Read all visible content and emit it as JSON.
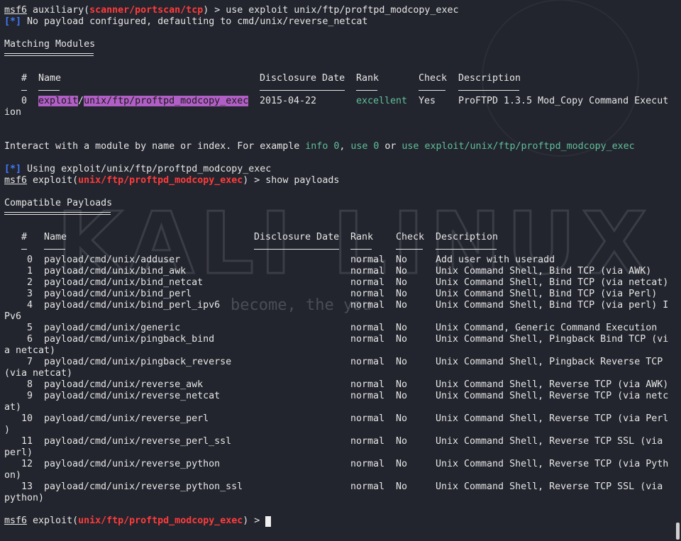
{
  "prompt1": {
    "user": "msf6",
    "prefix": " auxiliary(",
    "module": "scanner/portscan/tcp",
    "suffix": ") > ",
    "command": "use exploit unix/ftp/proftpd_modcopy_exec"
  },
  "info1": {
    "tag": "[*]",
    "text": " No payload configured, defaulting to cmd/unix/reverse_netcat"
  },
  "matching": {
    "title": "Matching Modules",
    "headers": {
      "num": "#",
      "name": "Name",
      "date": "Disclosure Date",
      "rank": "Rank",
      "check": "Check",
      "desc": "Description"
    },
    "row": {
      "num": "0",
      "name_a": "exploit",
      "name_sep": "/",
      "name_b": "unix/ftp/proftpd_modcopy_exec",
      "date": "2015-04-22",
      "rank": "excellent",
      "check": "Yes",
      "desc": "ProFTPD 1.3.5 Mod_Copy Command Execut",
      "desc_wrap": "ion"
    }
  },
  "interact": {
    "a": "Interact with a module by name or index. For example ",
    "b": "info 0",
    "c": ", ",
    "d": "use 0",
    "e": " or ",
    "f": "use exploit/unix/ftp/proftpd_modcopy_exec"
  },
  "info2": {
    "tag": "[*]",
    "text": " Using exploit/unix/ftp/proftpd_modcopy_exec"
  },
  "prompt2": {
    "user": "msf6",
    "prefix": " exploit(",
    "module": "unix/ftp/proftpd_modcopy_exec",
    "suffix": ") > ",
    "command": "show payloads"
  },
  "payloads": {
    "title": "Compatible Payloads",
    "headers": {
      "num": "#",
      "name": "Name",
      "date": "Disclosure Date",
      "rank": "Rank",
      "check": "Check",
      "desc": "Description"
    },
    "rows": [
      {
        "num": "0",
        "name": "payload/cmd/unix/adduser",
        "rank": "normal",
        "check": "No",
        "desc": "Add user with useradd",
        "wrap": ""
      },
      {
        "num": "1",
        "name": "payload/cmd/unix/bind_awk",
        "rank": "normal",
        "check": "No",
        "desc": "Unix Command Shell, Bind TCP (via AWK)",
        "wrap": ""
      },
      {
        "num": "2",
        "name": "payload/cmd/unix/bind_netcat",
        "rank": "normal",
        "check": "No",
        "desc": "Unix Command Shell, Bind TCP (via netcat)",
        "wrap": ""
      },
      {
        "num": "3",
        "name": "payload/cmd/unix/bind_perl",
        "rank": "normal",
        "check": "No",
        "desc": "Unix Command Shell, Bind TCP (via Perl)",
        "wrap": ""
      },
      {
        "num": "4",
        "name": "payload/cmd/unix/bind_perl_ipv6",
        "rank": "normal",
        "check": "No",
        "desc": "Unix Command Shell, Bind TCP (via perl) I",
        "wrap": "Pv6"
      },
      {
        "num": "5",
        "name": "payload/cmd/unix/generic",
        "rank": "normal",
        "check": "No",
        "desc": "Unix Command, Generic Command Execution",
        "wrap": ""
      },
      {
        "num": "6",
        "name": "payload/cmd/unix/pingback_bind",
        "rank": "normal",
        "check": "No",
        "desc": "Unix Command Shell, Pingback Bind TCP (vi",
        "wrap": "a netcat)"
      },
      {
        "num": "7",
        "name": "payload/cmd/unix/pingback_reverse",
        "rank": "normal",
        "check": "No",
        "desc": "Unix Command Shell, Pingback Reverse TCP",
        "wrap": "(via netcat)"
      },
      {
        "num": "8",
        "name": "payload/cmd/unix/reverse_awk",
        "rank": "normal",
        "check": "No",
        "desc": "Unix Command Shell, Reverse TCP (via AWK)",
        "wrap": ""
      },
      {
        "num": "9",
        "name": "payload/cmd/unix/reverse_netcat",
        "rank": "normal",
        "check": "No",
        "desc": "Unix Command Shell, Reverse TCP (via netc",
        "wrap": "at)"
      },
      {
        "num": "10",
        "name": "payload/cmd/unix/reverse_perl",
        "rank": "normal",
        "check": "No",
        "desc": "Unix Command Shell, Reverse TCP (via Perl",
        "wrap": ")"
      },
      {
        "num": "11",
        "name": "payload/cmd/unix/reverse_perl_ssl",
        "rank": "normal",
        "check": "No",
        "desc": "Unix Command Shell, Reverse TCP SSL (via",
        "wrap": "perl)"
      },
      {
        "num": "12",
        "name": "payload/cmd/unix/reverse_python",
        "rank": "normal",
        "check": "No",
        "desc": "Unix Command Shell, Reverse TCP (via Pyth",
        "wrap": "on)"
      },
      {
        "num": "13",
        "name": "payload/cmd/unix/reverse_python_ssl",
        "rank": "normal",
        "check": "No",
        "desc": "Unix Command Shell, Reverse TCP SSL (via",
        "wrap": "python)"
      }
    ]
  },
  "prompt3": {
    "user": "msf6",
    "prefix": " exploit(",
    "module": "unix/ftp/proftpd_modcopy_exec",
    "suffix": ") > "
  },
  "watermark": {
    "logo_text": "KALI LINUX",
    "slogan": "become, the         you"
  },
  "colors": {
    "background": "#23252e",
    "foreground": "#e6e6e6",
    "prompt_module": "#ff3b3b",
    "info_tag": "#3d7bff",
    "rank_excellent": "#5fbf9a",
    "highlight": "#b15fc6"
  }
}
